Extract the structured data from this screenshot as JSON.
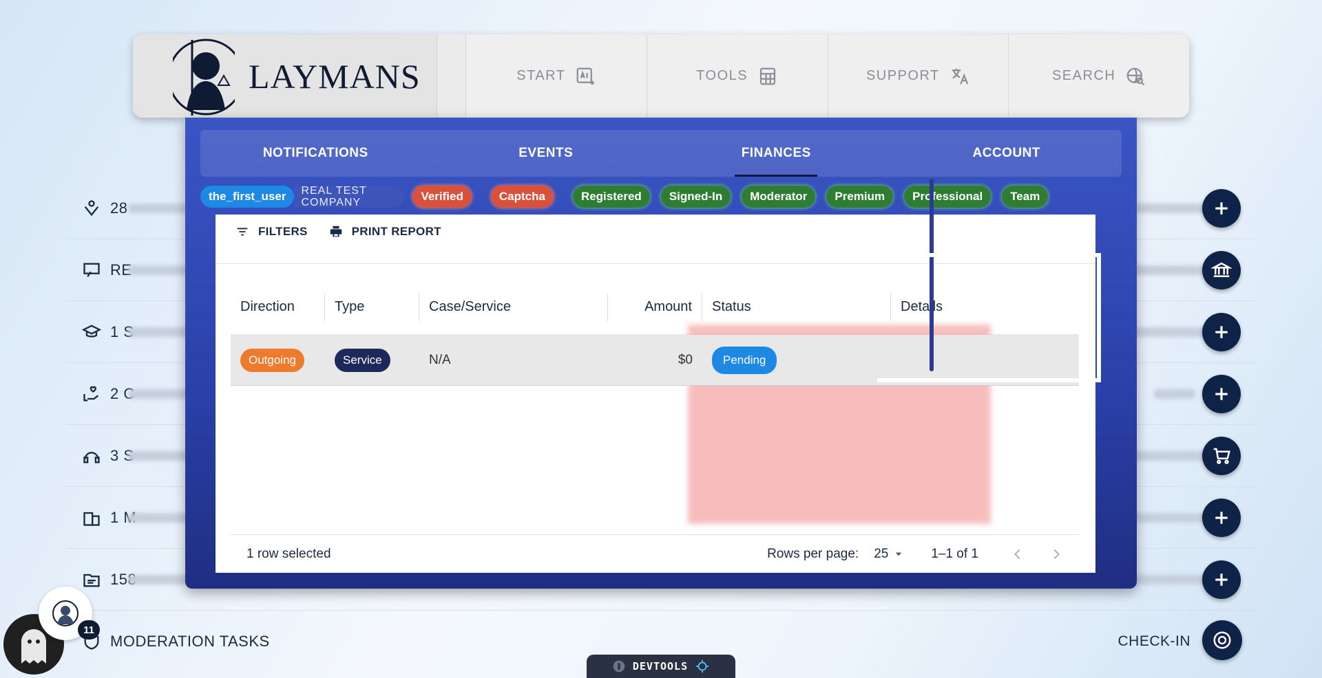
{
  "background_rows": [
    {
      "icon": "inbox-user-icon",
      "text": "28"
    },
    {
      "icon": "teacher-board-icon",
      "text": "RE"
    },
    {
      "icon": "graduation-cap-icon",
      "text": "1 S"
    },
    {
      "icon": "hand-heart-icon",
      "text": "2 C"
    },
    {
      "icon": "headset-icon",
      "text": "3 S"
    },
    {
      "icon": "building-icon",
      "text": "1 M"
    },
    {
      "icon": "folder-icon",
      "text": "158"
    }
  ],
  "fabs": [
    "plus-icon",
    "bank-icon",
    "plus-icon",
    "plus-icon",
    "cart-icon",
    "plus-icon",
    "plus-icon"
  ],
  "moderation_label": "MODERATION TASKS",
  "checkin_label": "CHECK-IN",
  "notification_count": "11",
  "devtools_label": "DEVTOOLS",
  "brand": {
    "name": "LAYMANS"
  },
  "nav": [
    {
      "label": "START",
      "icon": "ai-icon"
    },
    {
      "label": "TOOLS",
      "icon": "calculator-icon"
    },
    {
      "label": "SUPPORT",
      "icon": "translate-icon"
    },
    {
      "label": "SEARCH",
      "icon": "search-globe-icon"
    }
  ],
  "tabs": [
    "NOTIFICATIONS",
    "EVENTS",
    "FINANCES",
    "ACCOUNT"
  ],
  "active_tab": "FINANCES",
  "user": {
    "username": "the_first_user",
    "company_line1": "REAL TEST",
    "company_line2": "COMPANY"
  },
  "badges": [
    {
      "label": "Verified",
      "color": "#d9513a"
    },
    {
      "label": "Captcha",
      "color": "#d9513a"
    },
    {
      "label": "Registered",
      "color": "#2e7d32"
    },
    {
      "label": "Signed-In",
      "color": "#2e7d32"
    },
    {
      "label": "Moderator",
      "color": "#2e7d32"
    },
    {
      "label": "Premium",
      "color": "#2e7d32"
    },
    {
      "label": "Professional",
      "color": "#2e7d32"
    },
    {
      "label": "Team",
      "color": "#2e7d32"
    }
  ],
  "toolbar": {
    "filters": "FILTERS",
    "print": "PRINT REPORT"
  },
  "columns": [
    "Direction",
    "Type",
    "Case/Service",
    "Amount",
    "Status",
    "Details"
  ],
  "rows": [
    {
      "direction": "Outgoing",
      "type": "Service",
      "case": "N/A",
      "amount": "$0",
      "status": "Pending",
      "details": ""
    }
  ],
  "footer": {
    "selected": "1 row selected",
    "rows_per_page_label": "Rows per page:",
    "rows_per_page": "25",
    "range": "1–1 of 1"
  },
  "colors": {
    "outgoing": "#ee7a2c",
    "service": "#1b2a5a",
    "pending": "#1e88e5",
    "username": "#1e88e5"
  }
}
